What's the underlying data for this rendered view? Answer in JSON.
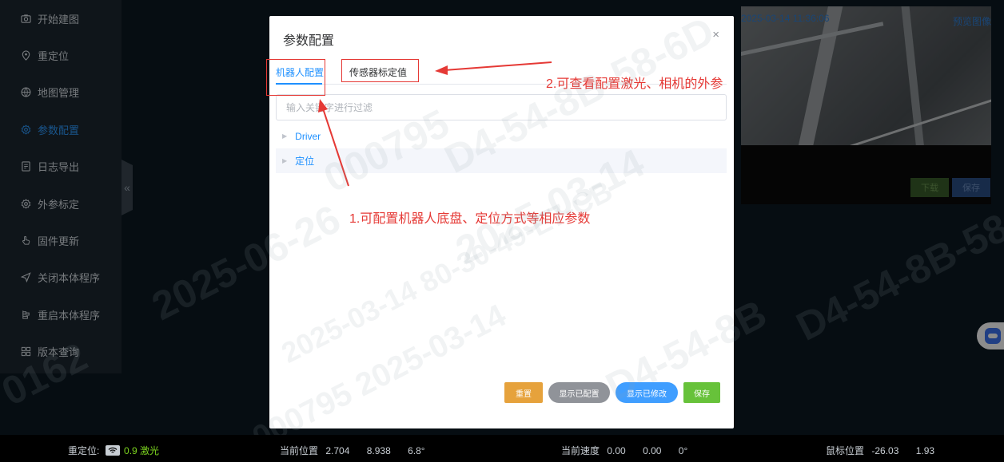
{
  "sidebar": {
    "items": [
      {
        "label": "开始建图",
        "icon": "camera-icon",
        "active": false
      },
      {
        "label": "重定位",
        "icon": "location-pin-icon",
        "active": false
      },
      {
        "label": "地图管理",
        "icon": "globe-icon",
        "active": false
      },
      {
        "label": "参数配置",
        "icon": "gear-icon",
        "active": true
      },
      {
        "label": "日志导出",
        "icon": "document-icon",
        "active": false
      },
      {
        "label": "外参标定",
        "icon": "gear-icon",
        "active": false
      },
      {
        "label": "固件更新",
        "icon": "hand-pointer-icon",
        "active": false
      },
      {
        "label": "关闭本体程序",
        "icon": "send-icon",
        "active": false
      },
      {
        "label": "重启本体程序",
        "icon": "restart-icon",
        "active": false
      },
      {
        "label": "版本查询",
        "icon": "grid-icon",
        "active": false
      }
    ],
    "collapse_icon": "«"
  },
  "camera": {
    "timestamp": "2025-03-14 11:36:06",
    "title": "预览图像",
    "download_label": "下载",
    "save_label": "保存"
  },
  "modal": {
    "title": "参数配置",
    "close_icon": "×",
    "tabs": [
      {
        "label": "机器人配置",
        "active": true
      },
      {
        "label": "传感器标定值",
        "active": false
      }
    ],
    "filter_placeholder": "输入关键字进行过滤",
    "tree": [
      {
        "label": "Driver"
      },
      {
        "label": "定位"
      }
    ],
    "buttons": {
      "reset": "重置",
      "show_configured": "显示已配置",
      "show_modified": "显示已修改",
      "save": "保存"
    }
  },
  "annotations": {
    "note1": "1.可配置机器人底盘、定位方式等相应参数",
    "note2": "2.可查看配置激光、相机的外参",
    "color": "#e53935"
  },
  "watermarks": [
    "2025-06-26",
    "2025-03-14",
    "80-30-49-E7-CB-F5",
    "D4-54-8B-58-6D",
    "000795",
    "2025-03-14 80-30-49-E7-CB",
    "000795 2025-03-14",
    "D4-54-8B",
    "0162"
  ],
  "statusbar": {
    "relocate_label": "重定位:",
    "relocate_value": "0.9 激光",
    "position_label": "当前位置",
    "position_x": "2.704",
    "position_y": "8.938",
    "position_theta": "6.8°",
    "speed_label": "当前速度",
    "speed_x": "0.00",
    "speed_y": "0.00",
    "speed_theta": "0°",
    "mouse_label": "鼠标位置",
    "mouse_x": "-26.03",
    "mouse_y": "1.93"
  }
}
